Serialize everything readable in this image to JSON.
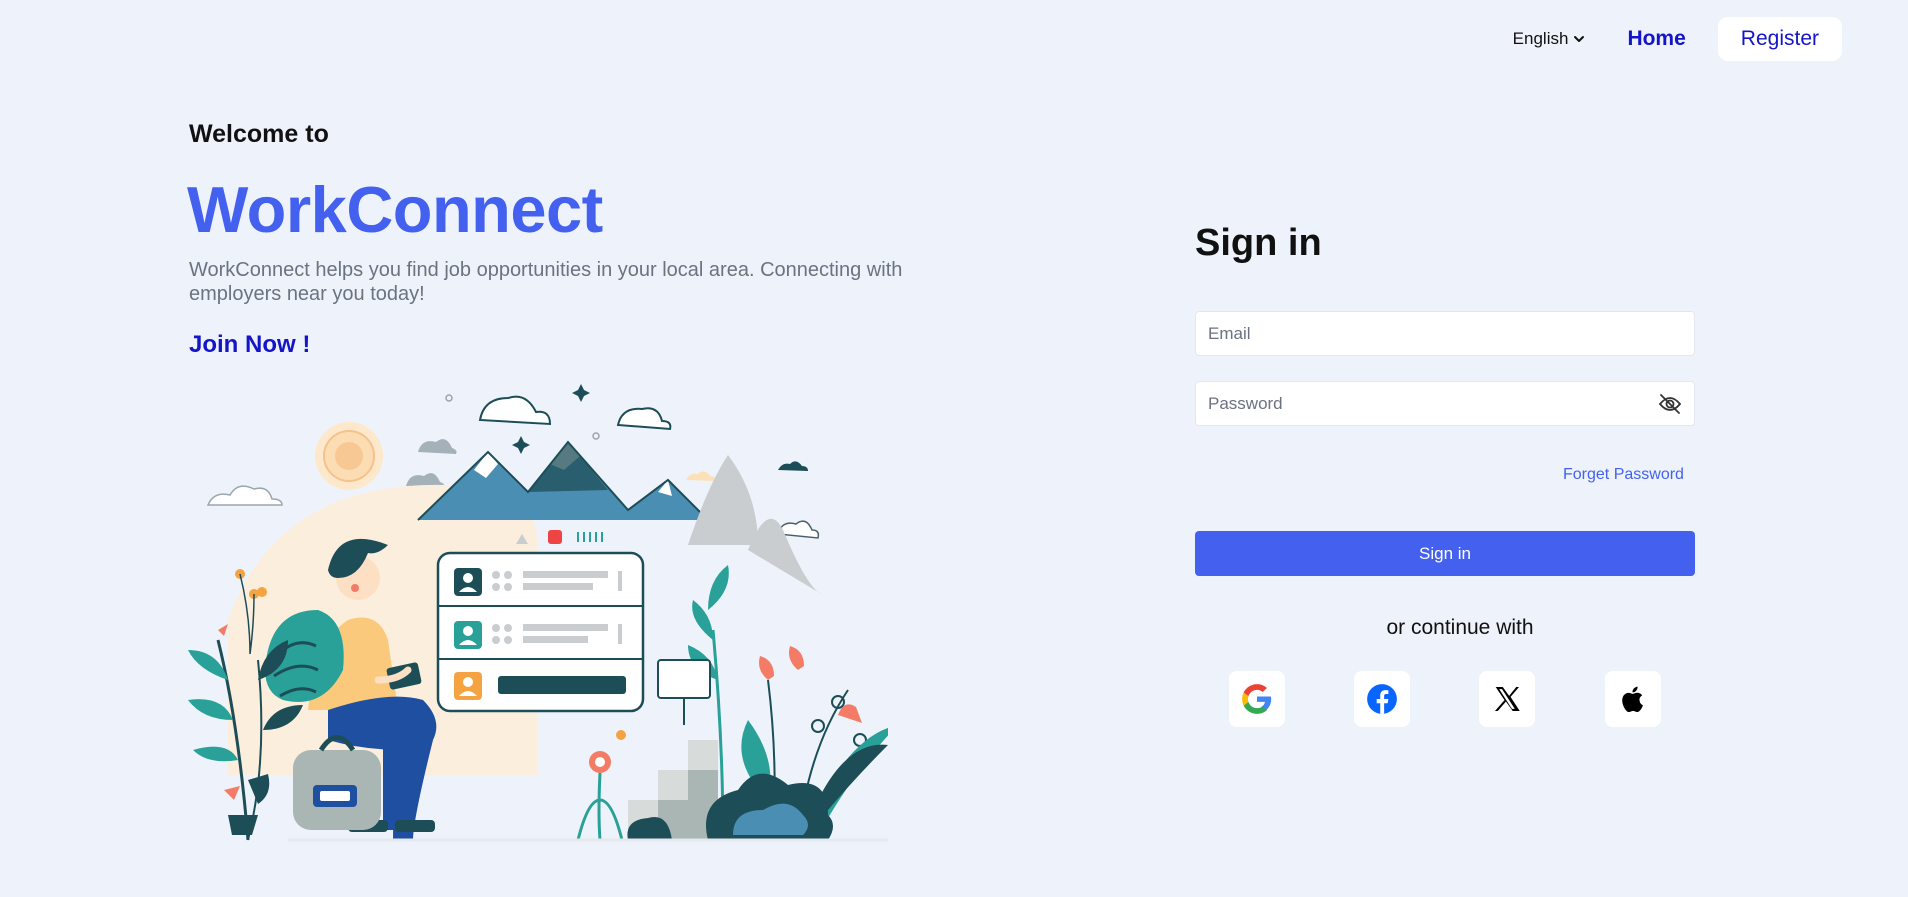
{
  "nav": {
    "language": "English",
    "home": "Home",
    "register": "Register"
  },
  "hero": {
    "welcome": "Welcome to",
    "brand": "WorkConnect",
    "tagline": "WorkConnect helps you find job opportunities in your local area. Connecting with employers near you today!",
    "join": "Join Now !"
  },
  "signin": {
    "title": "Sign in",
    "email_placeholder": "Email",
    "password_placeholder": "Password",
    "forget": "Forget Password",
    "button": "Sign in",
    "or_continue": "or continue with"
  },
  "social": [
    "google-icon",
    "facebook-icon",
    "x-icon",
    "apple-icon"
  ],
  "colors": {
    "background": "#eef3fb",
    "accent": "#4361ee",
    "link": "#1414c8",
    "muted_text": "#6b7280"
  }
}
